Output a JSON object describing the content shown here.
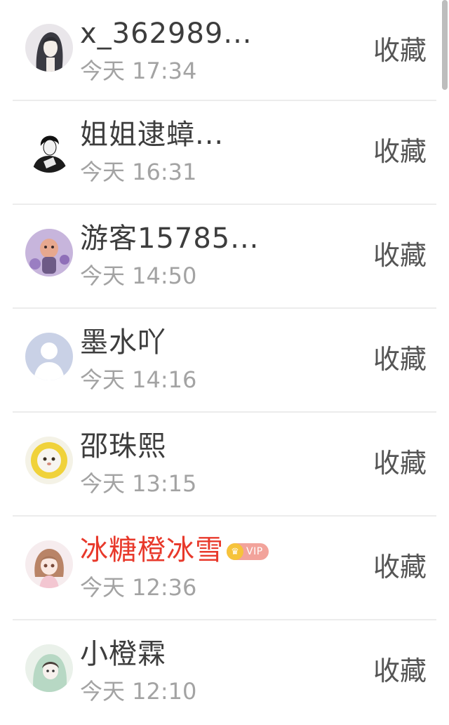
{
  "items": [
    {
      "name": "x_362989...",
      "time": "今天 17:34",
      "action": "收藏",
      "vip": false
    },
    {
      "name": "姐姐逮蟑...",
      "time": "今天 16:31",
      "action": "收藏",
      "vip": false
    },
    {
      "name": "游客15785...",
      "time": "今天 14:50",
      "action": "收藏",
      "vip": false
    },
    {
      "name": "墨水吖",
      "time": "今天 14:16",
      "action": "收藏",
      "vip": false
    },
    {
      "name": "邵珠熙",
      "time": "今天 13:15",
      "action": "收藏",
      "vip": false
    },
    {
      "name": "冰糖橙冰雪",
      "time": "今天 12:36",
      "action": "收藏",
      "vip": true,
      "badge": "VIP"
    },
    {
      "name": "小橙霖",
      "time": "今天 12:10",
      "action": "收藏",
      "vip": false
    }
  ],
  "colors": {
    "name": "#3d3d3d",
    "vip_name": "#e8392b",
    "time": "#a3a3a3",
    "action": "#555555",
    "divider": "#ececec"
  }
}
